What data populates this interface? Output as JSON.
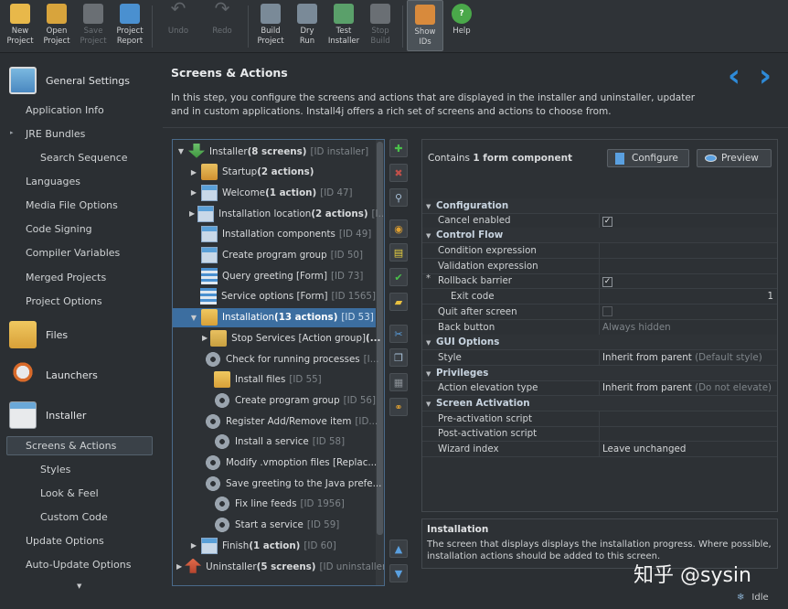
{
  "toolbar": [
    {
      "l1": "New",
      "l2": "Project",
      "dis": false,
      "color": "#e8b84a"
    },
    {
      "l1": "Open",
      "l2": "Project",
      "dis": false,
      "color": "#d8a43c"
    },
    {
      "l1": "Save",
      "l2": "Project",
      "dis": true,
      "color": "#6a6f74"
    },
    {
      "l1": "Project",
      "l2": "Report",
      "dis": false,
      "color": "#4a90d0"
    },
    {
      "l1": "Undo",
      "l2": "",
      "dis": true,
      "color": "#60656a"
    },
    {
      "l1": "Redo",
      "l2": "",
      "dis": true,
      "color": "#60656a"
    },
    {
      "l1": "Build",
      "l2": "Project",
      "dis": false,
      "color": "#7a8a98"
    },
    {
      "l1": "Dry",
      "l2": "Run",
      "dis": false,
      "color": "#7a8a98"
    },
    {
      "l1": "Test",
      "l2": "Installer",
      "dis": false,
      "color": "#5aa06a"
    },
    {
      "l1": "Stop",
      "l2": "Build",
      "dis": true,
      "color": "#6a6f74"
    },
    {
      "l1": "Show",
      "l2": "IDs",
      "dis": false,
      "color": "#d88a3c"
    },
    {
      "l1": "Help",
      "l2": "",
      "dis": false,
      "color": "#4aa84a"
    }
  ],
  "sidebar": {
    "general": "General Settings",
    "general_items": [
      "Application Info",
      "JRE Bundles",
      "Search Sequence",
      "Languages",
      "Media File Options",
      "Code Signing",
      "Compiler Variables",
      "Merged Projects",
      "Project Options"
    ],
    "files": "Files",
    "launchers": "Launchers",
    "installer": "Installer",
    "installer_items": [
      "Screens & Actions",
      "Styles",
      "Look & Feel",
      "Custom Code",
      "Update Options",
      "Auto-Update Options"
    ]
  },
  "main": {
    "title": "Screens & Actions",
    "description": "In this step, you configure the screens and actions that are displayed in the installer and uninstaller, updater and in custom applications. Install4j offers a rich set of screens and actions to choose from."
  },
  "tree": [
    {
      "arrow": "▼",
      "indent": 0,
      "pre": "Installer ",
      "bold": "(8 screens)",
      "post": "",
      "id": "[ID installer]",
      "icon": "inst"
    },
    {
      "arrow": "▶",
      "indent": 1,
      "pre": "Startup ",
      "bold": "(2 actions)",
      "post": "",
      "id": "",
      "icon": "startup"
    },
    {
      "arrow": "▶",
      "indent": 1,
      "pre": "Welcome ",
      "bold": "(1 action)",
      "post": "",
      "id": "[ID 47]",
      "icon": "screen"
    },
    {
      "arrow": "▶",
      "indent": 1,
      "pre": "Installation location ",
      "bold": "(2 actions)",
      "post": "",
      "id": "[I...",
      "icon": "screen"
    },
    {
      "arrow": "",
      "indent": 1,
      "pre": "Installation components",
      "bold": "",
      "post": "",
      "id": "[ID 49]",
      "icon": "screen"
    },
    {
      "arrow": "",
      "indent": 1,
      "pre": "Create program group",
      "bold": "",
      "post": "",
      "id": "[ID 50]",
      "icon": "screen"
    },
    {
      "arrow": "",
      "indent": 1,
      "pre": "Query greeting [Form]",
      "bold": "",
      "post": "",
      "id": "[ID 73]",
      "icon": "form"
    },
    {
      "arrow": "",
      "indent": 1,
      "pre": "Service options [Form]",
      "bold": "",
      "post": "",
      "id": "[ID 1565]",
      "icon": "form"
    },
    {
      "arrow": "▼",
      "indent": 1,
      "pre": "Installation ",
      "bold": "(13 actions)",
      "post": "",
      "id": "[ID 53]",
      "icon": "folder",
      "sel": true
    },
    {
      "arrow": "▶",
      "indent": 2,
      "pre": "Stop Services [Action group] ",
      "bold": "(...",
      "post": "",
      "id": "",
      "icon": "group"
    },
    {
      "arrow": "",
      "indent": 2,
      "pre": "Check for running processes",
      "bold": "",
      "post": "",
      "id": "[I...",
      "icon": "gear"
    },
    {
      "arrow": "",
      "indent": 2,
      "pre": "Install files",
      "bold": "",
      "post": "",
      "id": "[ID 55]",
      "icon": "folder"
    },
    {
      "arrow": "",
      "indent": 2,
      "pre": "Create program group",
      "bold": "",
      "post": "",
      "id": "[ID 56]",
      "icon": "gear"
    },
    {
      "arrow": "",
      "indent": 2,
      "pre": "Register Add/Remove item",
      "bold": "",
      "post": "",
      "id": "[ID...",
      "icon": "gear"
    },
    {
      "arrow": "",
      "indent": 2,
      "pre": "Install a service",
      "bold": "",
      "post": "",
      "id": "[ID 58]",
      "icon": "gear"
    },
    {
      "arrow": "",
      "indent": 2,
      "pre": "Modify .vmoption files [Replac...",
      "bold": "",
      "post": "",
      "id": "",
      "icon": "gear"
    },
    {
      "arrow": "",
      "indent": 2,
      "pre": "Save greeting to the Java prefe...",
      "bold": "",
      "post": "",
      "id": "",
      "icon": "gear"
    },
    {
      "arrow": "",
      "indent": 2,
      "pre": "Fix line feeds",
      "bold": "",
      "post": "",
      "id": "[ID 1956]",
      "icon": "gear"
    },
    {
      "arrow": "",
      "indent": 2,
      "pre": "Start a service",
      "bold": "",
      "post": "",
      "id": "[ID 59]",
      "icon": "gear"
    },
    {
      "arrow": "▶",
      "indent": 1,
      "pre": "Finish ",
      "bold": "(1 action)",
      "post": "",
      "id": "[ID 60]",
      "icon": "screen"
    },
    {
      "arrow": "▶",
      "indent": 0,
      "pre": "Uninstaller ",
      "bold": "(5 screens)",
      "post": "",
      "id": "[ID uninstaller]",
      "icon": "uninst"
    }
  ],
  "props": {
    "contains_pre": "Contains ",
    "contains_bold": "1 form component",
    "configure": "Configure",
    "preview": "Preview",
    "rows": [
      {
        "type": "cat",
        "k": "Configuration"
      },
      {
        "type": "row",
        "k": "Cancel enabled",
        "v": "",
        "check": "on"
      },
      {
        "type": "cat",
        "k": "Control Flow"
      },
      {
        "type": "row",
        "k": "Condition expression",
        "v": ""
      },
      {
        "type": "row",
        "k": "Validation expression",
        "v": ""
      },
      {
        "type": "row",
        "k": "Rollback barrier",
        "v": "",
        "check": "on",
        "star": "*"
      },
      {
        "type": "row",
        "k": "Exit code",
        "v": "",
        "indent": true,
        "right": "1"
      },
      {
        "type": "row",
        "k": "Quit after screen",
        "v": "",
        "check": "off"
      },
      {
        "type": "row",
        "k": "Back button",
        "v": "",
        "grey": "Always hidden"
      },
      {
        "type": "cat",
        "k": "GUI Options"
      },
      {
        "type": "row",
        "k": "Style",
        "v": "Inherit from parent ",
        "grey": "(Default style)"
      },
      {
        "type": "cat",
        "k": "Privileges"
      },
      {
        "type": "row",
        "k": "Action elevation type",
        "v": "Inherit from parent ",
        "grey": "(Do not elevate)"
      },
      {
        "type": "cat",
        "k": "Screen Activation"
      },
      {
        "type": "row",
        "k": "Pre-activation script",
        "v": ""
      },
      {
        "type": "row",
        "k": "Post-activation script",
        "v": ""
      },
      {
        "type": "row",
        "k": "Wizard index",
        "v": "Leave unchanged"
      }
    ]
  },
  "info": {
    "title": "Installation",
    "text": "The screen that displays displays the installation progress. Where possible, installation actions should be added to this screen."
  },
  "status": "Idle",
  "watermark": "知乎 @sysin"
}
